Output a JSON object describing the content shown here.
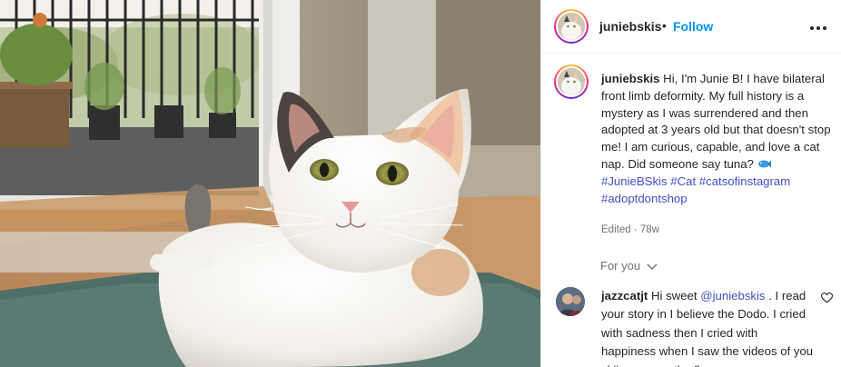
{
  "post": {
    "username": "juniebskis",
    "dot": "•",
    "follow_label": "Follow",
    "more_icon": "more-horizontal-icon"
  },
  "caption": {
    "username": "juniebskis",
    "text": "Hi, I'm Junie B! I have bilateral front limb deformity. My full history is a mystery as I was surrendered and then adopted at 3 years old but that doesn't stop me! I am curious, capable, and love a cat nap. Did someone say tuna?",
    "emoji_icon": "fish-icon",
    "hashtags": [
      "#JunieBSkis",
      "#Cat",
      "#catsofinstagram",
      "#adoptdontshop"
    ],
    "meta": "Edited · 78w"
  },
  "for_you_label": "For you",
  "comment": {
    "username": "jazzcatjt",
    "text_before": "Hi sweet",
    "mention": "@juniebskis",
    "text_after": ". I read your story in I believe the Dodo. I cried with sadness then I cried with happiness when I saw the videos of you skiing across the floor."
  },
  "colors": {
    "accent": "#0095f6",
    "link": "#4150c4",
    "muted": "#737373",
    "text": "#262626"
  }
}
